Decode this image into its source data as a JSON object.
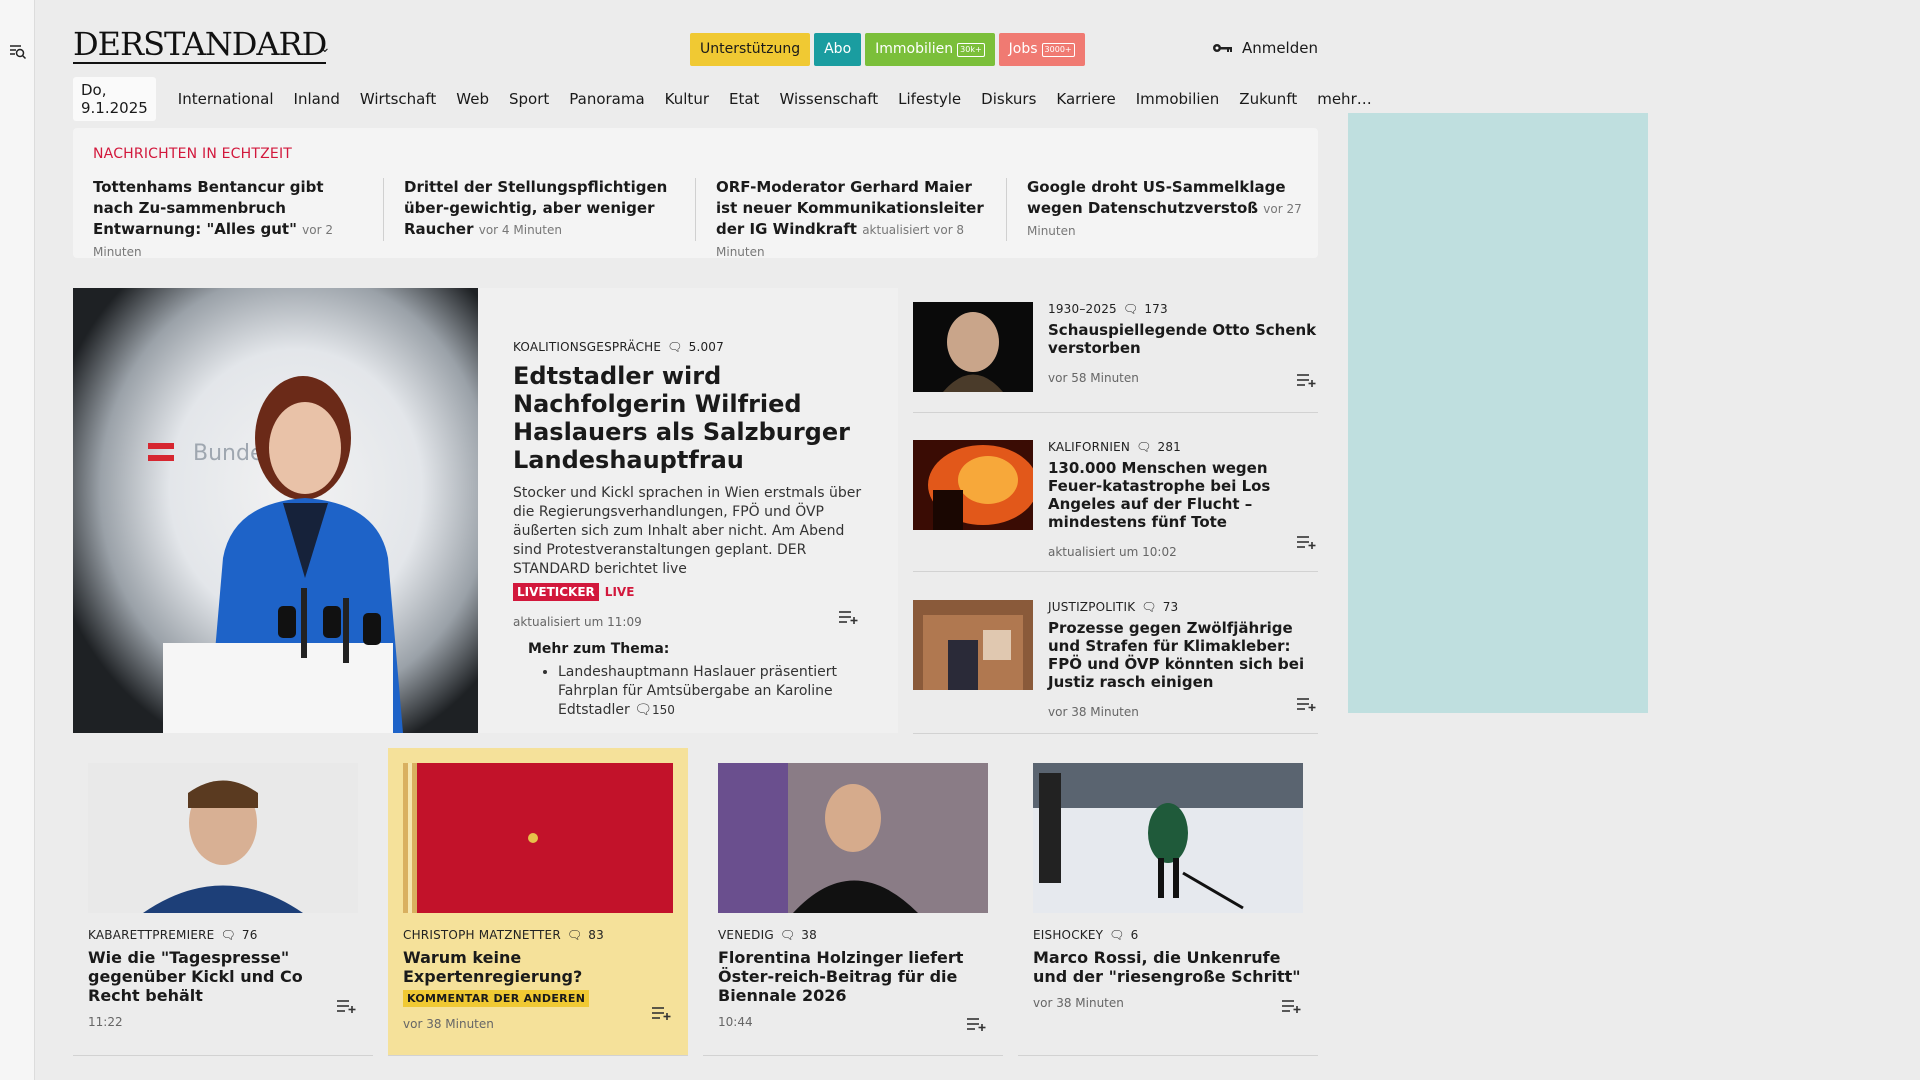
{
  "header": {
    "logo": "DERSTANDARD",
    "buttons": [
      {
        "label": "Unterstützung",
        "badge": "",
        "bg": "#f0c933",
        "fg": "#1a1a1a"
      },
      {
        "label": "Abo",
        "badge": "",
        "bg": "#1a9da0",
        "fg": "#ffffff"
      },
      {
        "label": "Immobilien",
        "badge": "30k+",
        "bg": "#7bbf3a",
        "fg": "#ffffff"
      },
      {
        "label": "Jobs",
        "badge": "3000+",
        "bg": "#f07a72",
        "fg": "#ffffff"
      }
    ],
    "login": "Anmelden"
  },
  "nav": {
    "date": "Do, 9.1.2025",
    "items": [
      "International",
      "Inland",
      "Wirtschaft",
      "Web",
      "Sport",
      "Panorama",
      "Kultur",
      "Etat",
      "Wissenschaft",
      "Lifestyle",
      "Diskurs",
      "Karriere",
      "Immobilien",
      "Zukunft",
      "mehr…"
    ]
  },
  "live": {
    "title": "NACHRICHTEN IN ECHTZEIT",
    "items": [
      {
        "headline": "Tottenhams Bentancur gibt nach Zu-sammenbruch Entwarnung: \"Alles gut\"",
        "time": "vor 2 Minuten"
      },
      {
        "headline": "Drittel der Stellungspflichtigen über-gewichtig, aber weniger Raucher",
        "time": "vor 4 Minuten"
      },
      {
        "headline": "ORF-Moderator Gerhard Maier ist neuer Kommunikationsleiter der IG Windkraft",
        "time": "aktualisiert vor 8 Minuten"
      },
      {
        "headline": "Google droht US-Sammelklage wegen Datenschutzverstoß",
        "time": "vor 27 Minuten"
      }
    ]
  },
  "main": {
    "kicker": "KOALITIONSGESPRÄCHE",
    "comments": "5.007",
    "headline": "Edtstadler wird Nachfolgerin Wilfried Haslauers als Salzburger Landeshauptfrau",
    "lead": "Stocker und Kickl sprachen in Wien erstmals über die Regierungsverhandlungen, FPÖ und ÖVP äußerten sich zum Inhalt aber nicht. Am Abend sind Protestveranstaltungen geplant. DER STANDARD berichtet live",
    "tag1": "LIVETICKER",
    "tag2": "LIVE",
    "time": "aktualisiert um 11:09",
    "more_title": "Mehr zum Thema:",
    "more_item": "Landeshauptmann Haslauer präsentiert Fahrplan für Amtsübergabe an Karoline Edtstadler",
    "more_comments": "150",
    "image_text": "Bundes"
  },
  "side": [
    {
      "kicker": "1930–2025",
      "comments": "173",
      "headline": "Schauspiellegende Otto Schenk verstorben",
      "time": "vor 58 Minuten"
    },
    {
      "kicker": "KALIFORNIEN",
      "comments": "281",
      "headline": "130.000 Menschen wegen Feuer-katastrophe bei Los Angeles auf der Flucht – mindestens fünf Tote",
      "time": "aktualisiert um 10:02"
    },
    {
      "kicker": "JUSTIZPOLITIK",
      "comments": "73",
      "headline": "Prozesse gegen Zwölfjährige und Strafen für Klimakleber: FPÖ und ÖVP könnten sich bei Justiz rasch einigen",
      "time": "vor 38 Minuten"
    }
  ],
  "cards": [
    {
      "kicker": "KABARETTPREMIERE",
      "comments": "76",
      "headline": "Wie die \"Tagespresse\" gegenüber Kickl und Co Recht behält",
      "badge": "",
      "time": "11:22"
    },
    {
      "kicker": "CHRISTOPH MATZNETTER",
      "comments": "83",
      "headline": "Warum keine Expertenregierung?",
      "badge": "KOMMENTAR DER ANDEREN",
      "time": "vor 38 Minuten"
    },
    {
      "kicker": "VENEDIG",
      "comments": "38",
      "headline": "Florentina Holzinger liefert Öster-reich-Beitrag für die Biennale 2026",
      "badge": "",
      "time": "10:44"
    },
    {
      "kicker": "EISHOCKEY",
      "comments": "6",
      "headline": "Marco Rossi, die Unkenrufe und der \"riesengroße Schritt\"",
      "badge": "",
      "time": "vor 38 Minuten"
    }
  ],
  "icons": [
    "search-menu-icon",
    "chevron-down-icon",
    "key-icon",
    "comment-icon",
    "add-to-list-icon"
  ],
  "colors": {
    "accent_red": "#d2183c",
    "ad_bg": "#bfdfdf",
    "comment_yellow": "#f5e19a"
  }
}
